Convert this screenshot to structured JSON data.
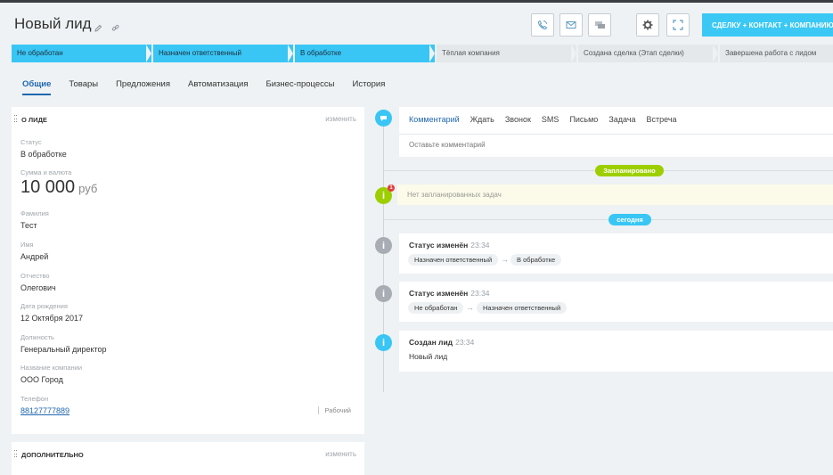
{
  "header": {
    "title": "Новый лид",
    "convert_button": "СДЕЛКУ + КОНТАКТ + КОМПАНИЮ"
  },
  "stages": [
    {
      "label": "Не обработан",
      "state": "active"
    },
    {
      "label": "Назначен ответственный",
      "state": "active"
    },
    {
      "label": "В обработке",
      "state": "active"
    },
    {
      "label": "Тёплая компания",
      "state": "inactive"
    },
    {
      "label": "Создана сделка (Этап сделки)",
      "state": "inactive"
    },
    {
      "label": "Завершена работа с лидом",
      "state": "inactive"
    }
  ],
  "stage_colors": {
    "active": "#39c6f5",
    "inactive": "#e4e8eb",
    "final_bar": "#7bd500"
  },
  "tabs": [
    "Общие",
    "Товары",
    "Предложения",
    "Автоматизация",
    "Бизнес-процессы",
    "История"
  ],
  "about": {
    "title": "О ЛИДЕ",
    "edit": "изменить",
    "status_label": "Статус",
    "status_value": "В обработке",
    "sum_label": "Сумма и валюта",
    "sum_value": "10 000",
    "currency": "руб",
    "lastname_label": "Фамилия",
    "lastname_value": "Тест",
    "name_label": "Имя",
    "name_value": "Андрей",
    "patronymic_label": "Отчество",
    "patronymic_value": "Олегович",
    "birthday_label": "Дата рождения",
    "birthday_value": "12 Октября 2017",
    "position_label": "Должность",
    "position_value": "Генеральный директор",
    "company_label": "Название компании",
    "company_value": "ООО Город",
    "phone_label": "Телефон",
    "phone_value": "88127777889",
    "phone_type": "Рабочий"
  },
  "additional": {
    "title": "ДОПОЛНИТЕЛЬНО",
    "edit": "изменить"
  },
  "timeline": {
    "comment_tabs": [
      "Комментарий",
      "Ждать",
      "Звонок",
      "SMS",
      "Письмо",
      "Задача",
      "Встреча"
    ],
    "comment_placeholder": "Оставьте комментарий",
    "planned_pill": "Запланировано",
    "empty_tasks": "Нет запланированных задач",
    "empty_badge": "1",
    "today_pill": "сегодня",
    "events": [
      {
        "title": "Статус изменён",
        "time": "23:34",
        "from": "Назначен ответственный",
        "to": "В обработке"
      },
      {
        "title": "Статус изменён",
        "time": "23:34",
        "from": "Не обработан",
        "to": "Назначен ответственный"
      },
      {
        "title": "Создан лид",
        "time": "23:34",
        "desc": "Новый лид"
      }
    ],
    "colors": {
      "blue": "#39c6f5",
      "green": "#9dcf00",
      "gray": "#a8adb4"
    }
  },
  "icons": {
    "title": [
      "pencil-icon",
      "link-icon"
    ],
    "header_buttons": [
      "phone-icon",
      "mail-icon",
      "chat-icon",
      "gear-icon",
      "expand-icon"
    ]
  }
}
